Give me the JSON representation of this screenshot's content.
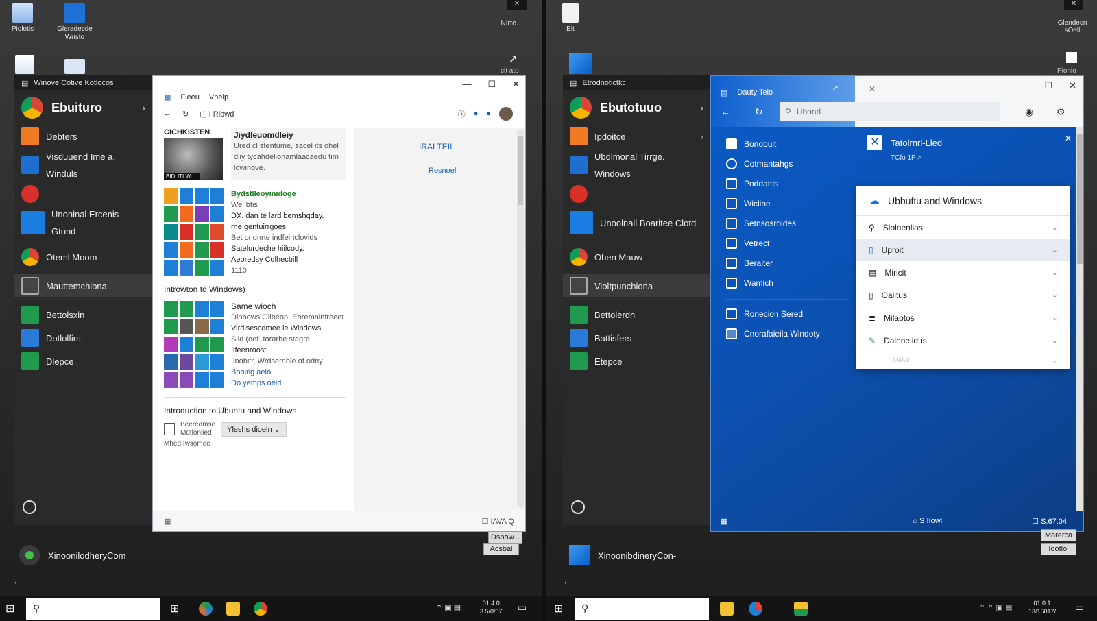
{
  "left": {
    "desktop_icons": [
      "Piolotis",
      "Gleradecde Wristo"
    ],
    "top_right_label": "Nirto..",
    "top_right_label2": "cit ato",
    "startmenu": {
      "title": "Winove Cotive Kotlocos",
      "hero": "Ebuituro",
      "items": [
        "Debters",
        "Visduuend Ime a. Winduls",
        "Unoninal Ercenis Gtond",
        "Oteml Moom",
        "Mauttemchiona",
        "Bettolsxin",
        "Dotlolfirs",
        "Dlepce"
      ],
      "bottom_user": "XinoonilodheryCom"
    },
    "browser": {
      "menu": [
        "Fieeu",
        "Vhelp"
      ],
      "address": "I Ribwd",
      "section_title": "CICHKISTEN",
      "thumb_caption": "BIDUTI Wu...",
      "card1_title": "Jiydleuomdleiy",
      "card1_text": "Ured cl stentume, sacel its ohel dliy tycahdelionamlaacaedu tim lowinove.",
      "card2_title": "Bydstlleoyinidoge",
      "card2_lines": [
        "Wel btis",
        "DX. dan te lard bemshqday.",
        "rne  gentuirrgoes",
        "Bet ondnrte indfeinclovids",
        "Satelurdeche hiilcody.",
        "Aeoredsy Cdlhecbill",
        "1110"
      ],
      "intro1": "Introwton td Windows)",
      "card3_title": "Same wioch",
      "card3_lines": [
        "Dinbows Glibeon, Eoremninfreeet",
        "Virdisescdmee le Windows.",
        "Slid (oef..torarhe stagre",
        "Ilfeenroost",
        "Ilnobitr, Wrdsernble of odriy",
        "Booing aelo",
        "Do yemps oeld"
      ],
      "intro2": "Introduction to Ubuntu and Windows",
      "footer_lines": [
        "Beeredmse",
        "Mdtlonlied",
        "Mhed Iwsomee"
      ],
      "dropdown": "Yleshs dioeln",
      "right_link1": "IRAI TEII",
      "right_link2": "Resnoel",
      "status_right": "IAVA Q"
    },
    "btn1": "Dsbow...",
    "btn2": "Acsbal",
    "clock": [
      "01 4.0",
      "3.5/0/07"
    ]
  },
  "right": {
    "desktop_icons": [
      "Eit"
    ],
    "top_right_label": "Glendecn sOell",
    "top_right_label2": "Pionlo",
    "startmenu": {
      "title": "Etrodnotictkc",
      "hero": "Ebutotuuo",
      "items": [
        "Ipdoitce",
        "Ubdlmonal Tirrge. Windows",
        "Unoolnall Boaritee Clotd",
        "Oben Mauw",
        "Violtpunchiona",
        "Bettolerdn",
        "Battisfers",
        "Etepce"
      ],
      "bottom_user": "XinoonibdineryCon-"
    },
    "app": {
      "title": "Dauty Teio",
      "search": "Ubonrl",
      "list": [
        "Bonobuit",
        "Cotmantahgs",
        "Poddattls",
        "Wicline",
        "Setnsosroldes",
        "Vetrect",
        "Beraiter",
        "Wamich"
      ],
      "list2": [
        "Ronecion Sered",
        "Cnorafaieila Windoty"
      ],
      "header_title": "Tatolrnrl-Lled",
      "header_sub": "TCfo  1P  >",
      "panel_title": "Ubbuftu and Windows",
      "panel_items": [
        "Slolnenlias",
        "Uproit",
        "Miricit",
        "Oalltus",
        "Milaotos",
        "Dalenelidus",
        "AMAB"
      ],
      "status_mid": "S IIowl",
      "status_right": "S.67.04"
    },
    "btn1": "Marerca",
    "btn2": "Iootlol",
    "clock": [
      "01:0:1",
      "13/15017/"
    ]
  }
}
